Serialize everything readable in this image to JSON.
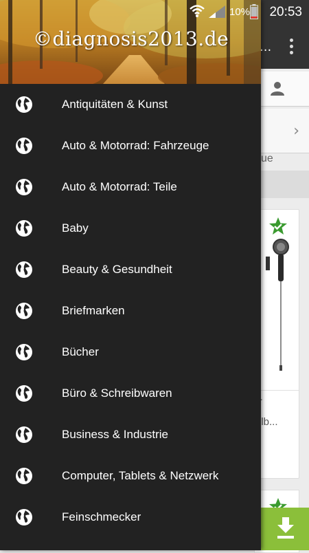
{
  "status_bar": {
    "battery_percent": "10%",
    "time": "20:53"
  },
  "drawer": {
    "header_watermark": "©diagnosis2013.de",
    "items": [
      {
        "label": "Antiquitäten & Kunst",
        "icon": "globe-icon"
      },
      {
        "label": "Auto & Motorrad: Fahrzeuge",
        "icon": "globe-icon"
      },
      {
        "label": "Auto & Motorrad: Teile",
        "icon": "globe-icon"
      },
      {
        "label": "Baby",
        "icon": "globe-icon"
      },
      {
        "label": "Beauty & Gesundheit",
        "icon": "globe-icon"
      },
      {
        "label": "Briefmarken",
        "icon": "globe-icon"
      },
      {
        "label": "Bücher",
        "icon": "globe-icon"
      },
      {
        "label": "Büro & Schreibwaren",
        "icon": "globe-icon"
      },
      {
        "label": "Business & Industrie",
        "icon": "globe-icon"
      },
      {
        "label": "Computer, Tablets & Netzwerk",
        "icon": "globe-icon"
      },
      {
        "label": "Feinschmecker",
        "icon": "globe-icon"
      }
    ]
  },
  "background": {
    "toolbar_ellipsis": "...",
    "partial_text_ue": "ue",
    "card_text_1": "r",
    "card_text_2": "llb...",
    "accent_color": "#8bbf3a"
  }
}
